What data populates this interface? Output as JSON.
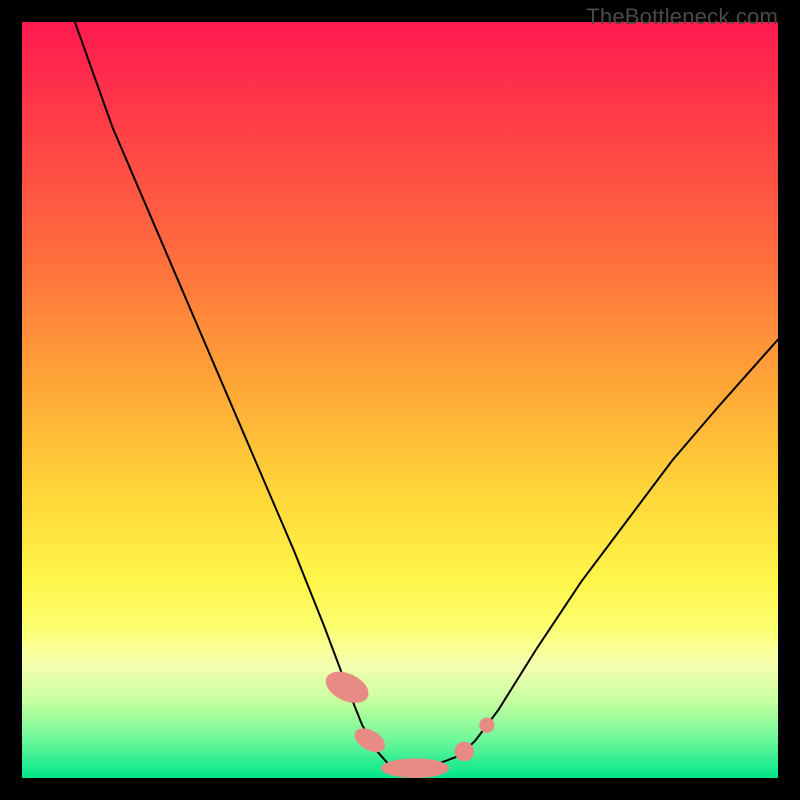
{
  "attribution": "TheBottleneck.com",
  "chart_data": {
    "type": "line",
    "title": "",
    "xlabel": "",
    "ylabel": "",
    "xlim": [
      0,
      100
    ],
    "ylim": [
      0,
      100
    ],
    "grid": false,
    "series": [
      {
        "name": "left-curve",
        "x": [
          7,
          12,
          18,
          24,
          30,
          36,
          40,
          43,
          45,
          47,
          48.5,
          50
        ],
        "y": [
          100,
          86,
          72,
          58,
          44,
          30,
          20,
          12,
          7,
          3.5,
          1.8,
          1.2
        ]
      },
      {
        "name": "right-curve",
        "x": [
          50,
          54,
          58,
          60,
          63,
          68,
          74,
          80,
          86,
          92,
          100
        ],
        "y": [
          1.2,
          1.5,
          3,
          5,
          9,
          17,
          26,
          34,
          42,
          49,
          58
        ]
      }
    ],
    "markers": [
      {
        "shape": "pill",
        "cx": 43.0,
        "cy": 12.0,
        "rx": 1.8,
        "ry": 3.0,
        "angle": -65
      },
      {
        "shape": "pill",
        "cx": 46.0,
        "cy": 5.0,
        "rx": 1.3,
        "ry": 2.2,
        "angle": -60
      },
      {
        "shape": "pill",
        "cx": 52.0,
        "cy": 1.3,
        "rx": 4.5,
        "ry": 1.3,
        "angle": 0
      },
      {
        "shape": "circle",
        "cx": 58.5,
        "cy": 3.5,
        "r": 1.3
      },
      {
        "shape": "circle",
        "cx": 61.5,
        "cy": 7.0,
        "r": 1.0
      }
    ],
    "colors": {
      "curve": "#000000",
      "marker_fill": "#e88b84"
    }
  }
}
